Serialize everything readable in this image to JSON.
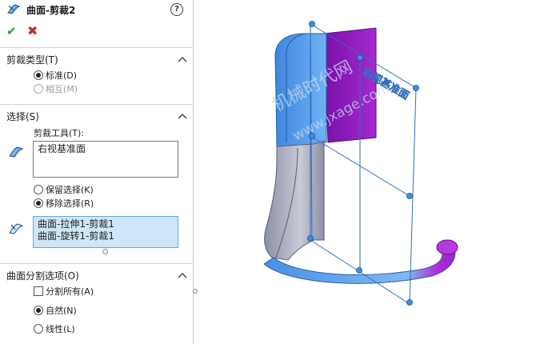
{
  "header": {
    "title": "曲面-剪裁2",
    "help": "?",
    "ok": "✔",
    "cancel": "✖"
  },
  "trim_type": {
    "title": "剪裁类型(T)",
    "options": [
      {
        "label": "标准(D)",
        "selected": true,
        "enabled": true
      },
      {
        "label": "相互(M)",
        "selected": false,
        "enabled": false
      }
    ]
  },
  "selections": {
    "title": "选择(S)",
    "trim_tool_label": "剪裁工具(T):",
    "trim_tool_value": "右视基准面",
    "keep_options": [
      {
        "label": "保留选择(K)",
        "selected": false
      },
      {
        "label": "移除选择(R)",
        "selected": true
      }
    ],
    "pieces": [
      "曲面-拉伸1-剪裁1",
      "曲面-旋转1-剪裁1"
    ]
  },
  "split_options": {
    "title": "曲面分割选项(O)",
    "split_all": {
      "label": "分割所有(A)",
      "checked": false
    },
    "options": [
      {
        "label": "自然(N)",
        "selected": true
      },
      {
        "label": "线性(L)",
        "selected": false
      }
    ]
  },
  "viewport": {
    "watermark": "机械时代网",
    "watermark_url": "www.jxage.com",
    "plane_label": "右视基准面"
  },
  "colors": {
    "surface_blue": "#5aa0ee",
    "surface_purple": "#a020c8",
    "surface_gray": "#b9b9c8"
  }
}
